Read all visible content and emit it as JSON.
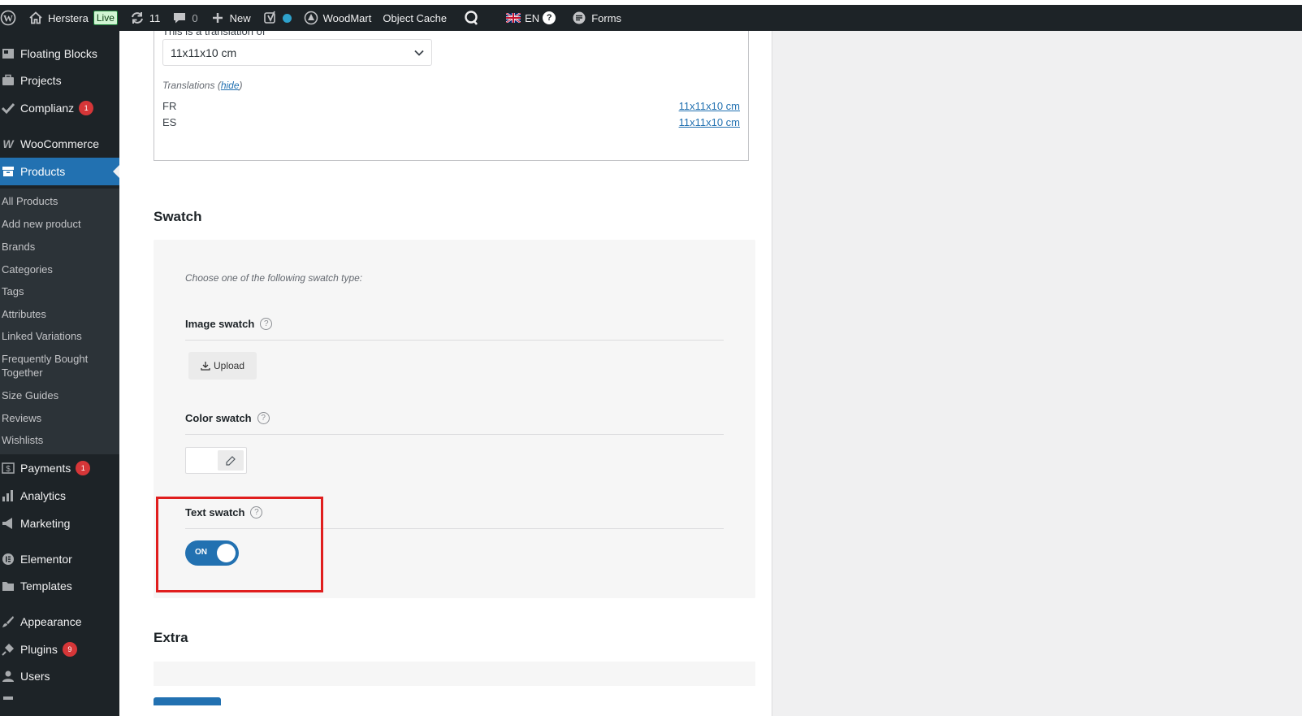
{
  "adminbar": {
    "site_name": "Herstera",
    "live_label": "Live",
    "updates_count": "11",
    "comments_count": "0",
    "new_label": "New",
    "woodmart_label": "WoodMart",
    "object_cache_label": "Object Cache",
    "language_label": "EN",
    "forms_label": "Forms"
  },
  "sidebar": {
    "items": [
      {
        "label": "Floating Blocks",
        "icon": "blocks-icon"
      },
      {
        "label": "Projects",
        "icon": "briefcase-icon"
      },
      {
        "label": "Complianz",
        "icon": "check-icon",
        "badge": "1"
      },
      {
        "label": "WooCommerce",
        "icon": "woo-icon"
      },
      {
        "label": "Products",
        "icon": "archive-icon"
      },
      {
        "label": "Payments",
        "icon": "dollar-icon",
        "badge": "1"
      },
      {
        "label": "Analytics",
        "icon": "bar-chart-icon"
      },
      {
        "label": "Marketing",
        "icon": "megaphone-icon"
      },
      {
        "label": "Elementor",
        "icon": "elementor-icon"
      },
      {
        "label": "Templates",
        "icon": "folder-icon"
      },
      {
        "label": "Appearance",
        "icon": "paintbrush-icon"
      },
      {
        "label": "Plugins",
        "icon": "plug-icon",
        "badge": "9"
      },
      {
        "label": "Users",
        "icon": "user-icon"
      }
    ],
    "submenu": [
      "All Products",
      "Add new product",
      "Brands",
      "Categories",
      "Tags",
      "Attributes",
      "Linked Variations",
      "Frequently Bought Together",
      "Size Guides",
      "Reviews",
      "Wishlists"
    ]
  },
  "translation": {
    "heading": "This is a translation of",
    "selected_value": "11x11x10 cm",
    "translations_label": "Translations",
    "hide_label": "hide",
    "rows": [
      {
        "lang": "FR",
        "value": "11x11x10 cm"
      },
      {
        "lang": "ES",
        "value": "11x11x10 cm"
      }
    ]
  },
  "swatch": {
    "title": "Swatch",
    "hint": "Choose one of the following swatch type:",
    "image_label": "Image swatch",
    "upload_label": "Upload",
    "color_label": "Color swatch",
    "text_label": "Text swatch",
    "toggle_label": "ON",
    "toggle_state": true
  },
  "extra": {
    "title": "Extra"
  },
  "colors": {
    "accent": "#2271b1",
    "adminbar": "#1d2327",
    "highlight": "#e01e1e",
    "badge": "#d63638"
  }
}
